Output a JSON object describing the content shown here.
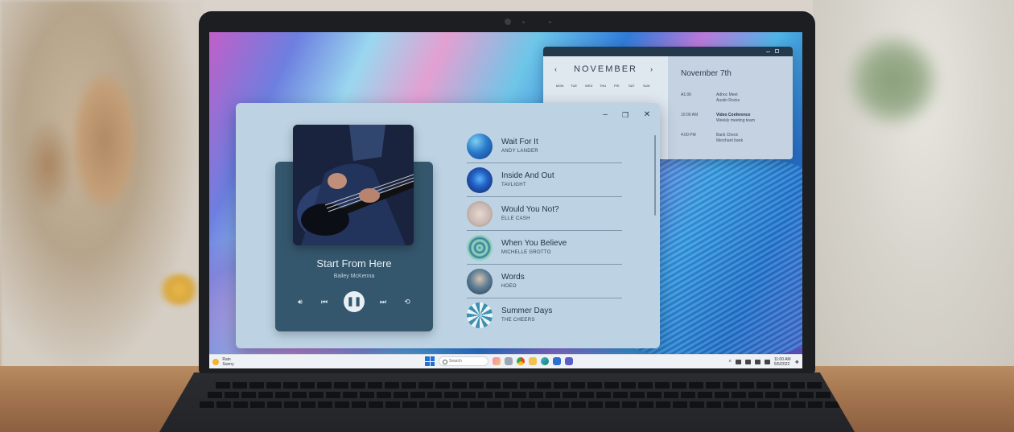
{
  "calendar": {
    "month": "NOVEMBER",
    "weekdays": [
      "MON",
      "TUE",
      "WED",
      "THU",
      "FRI",
      "SAT",
      "SUN"
    ],
    "selected_date": "November 7th",
    "events": [
      {
        "time": "A1:00",
        "title": "Adhoc Meet",
        "subtitle": "Austin Rocks"
      },
      {
        "time": "10:00 AM",
        "title": "Video Conference",
        "subtitle": "Weekly meeting team"
      },
      {
        "time": "4:00 PM",
        "title": "Bank Check",
        "subtitle": "Merchant bank"
      }
    ]
  },
  "player": {
    "now_playing": {
      "title": "Start From Here",
      "artist": "Bailey McKenna"
    },
    "tracks": [
      {
        "title": "Wait For It",
        "artist": "ANDY LANDER"
      },
      {
        "title": "Inside And Out",
        "artist": "TAVLIGHT"
      },
      {
        "title": "Would You Not?",
        "artist": "ELLE CASH"
      },
      {
        "title": "When You Believe",
        "artist": "MICHELLE GROTTO"
      },
      {
        "title": "Words",
        "artist": "HOEO"
      },
      {
        "title": "Summer Days",
        "artist": "THE CHEERS"
      }
    ]
  },
  "taskbar": {
    "weather": "Rain",
    "weather_sub": "Sunny",
    "search_placeholder": "Search",
    "time": "11:00 AM",
    "date": "5/5/2022"
  }
}
